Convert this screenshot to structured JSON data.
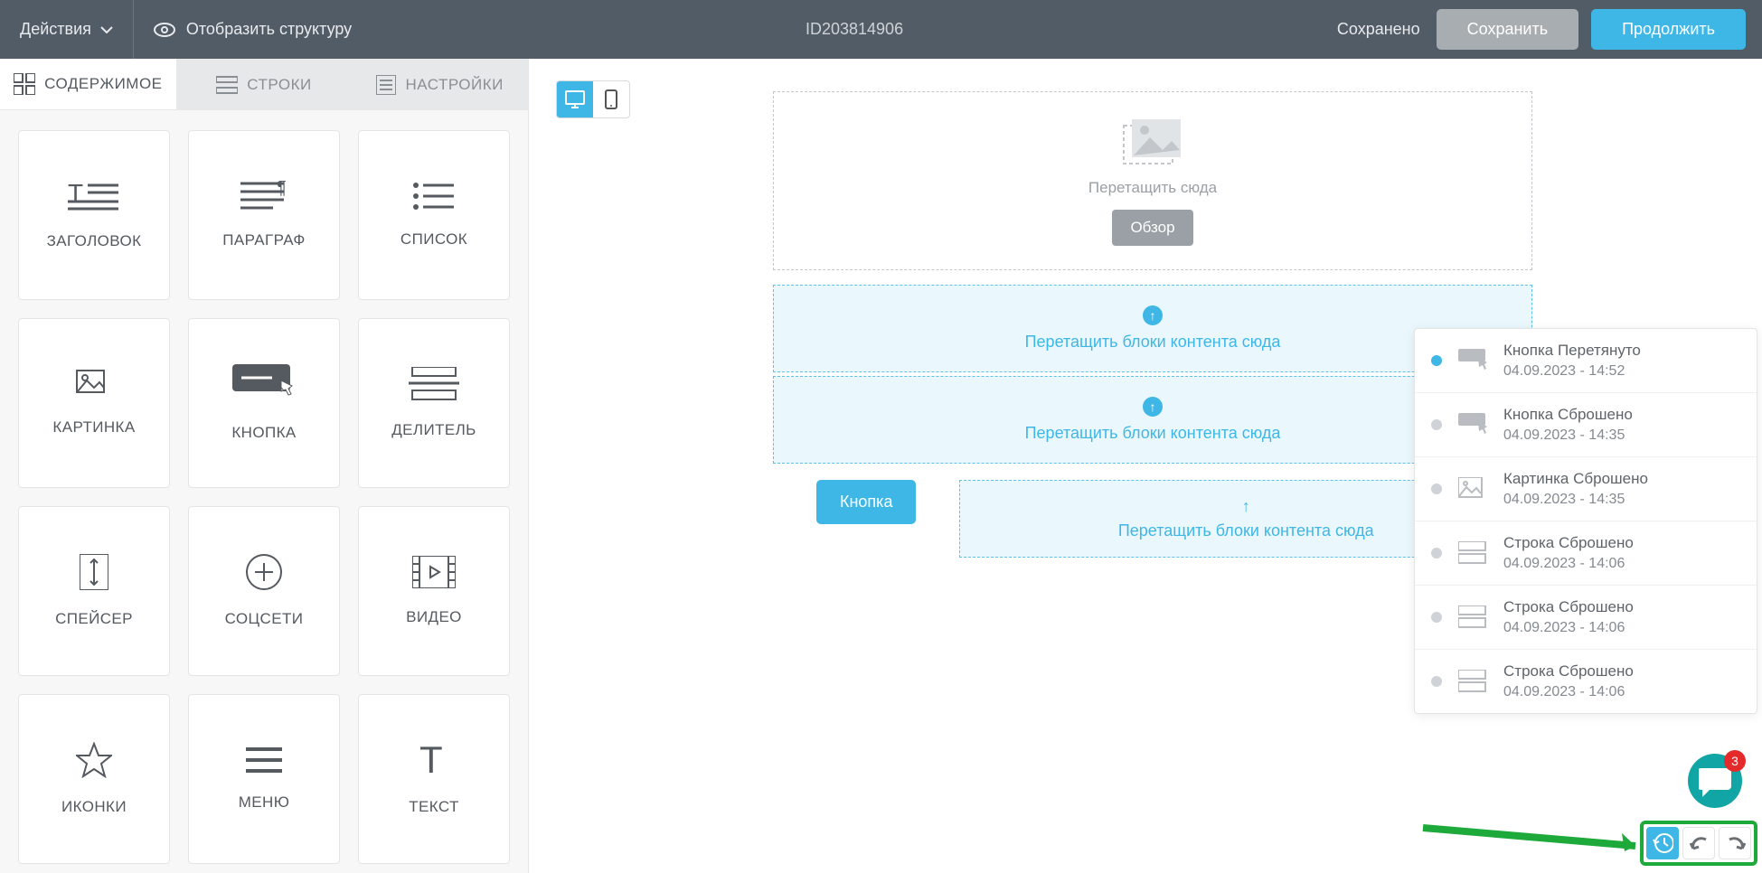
{
  "topbar": {
    "actions_label": "Действия",
    "show_structure_label": "Отобразить структуру",
    "doc_id": "ID203814906",
    "status_label": "Сохранено",
    "save_label": "Сохранить",
    "continue_label": "Продолжить"
  },
  "sidebar": {
    "tabs": {
      "content": "СОДЕРЖИМОЕ",
      "rows": "СТРОКИ",
      "settings": "НАСТРОЙКИ"
    },
    "blocks": [
      {
        "key": "heading",
        "label": "ЗАГОЛОВОК"
      },
      {
        "key": "paragraph",
        "label": "ПАРАГРАФ"
      },
      {
        "key": "list",
        "label": "СПИСОК"
      },
      {
        "key": "image",
        "label": "КАРТИНКА"
      },
      {
        "key": "button",
        "label": "КНОПКА"
      },
      {
        "key": "divider",
        "label": "ДЕЛИТЕЛЬ"
      },
      {
        "key": "spacer",
        "label": "СПЕЙСЕР"
      },
      {
        "key": "social",
        "label": "СОЦСЕТИ"
      },
      {
        "key": "video",
        "label": "ВИДЕО"
      },
      {
        "key": "icons",
        "label": "ИКОНКИ"
      },
      {
        "key": "menu",
        "label": "МЕНЮ"
      },
      {
        "key": "text",
        "label": "ТЕКСТ"
      }
    ]
  },
  "canvas": {
    "image_drop_hint": "Перетащить сюда",
    "browse_label": "Обзор",
    "content_drop_hint": "Перетащить блоки контента сюда",
    "button_element_label": "Кнопка"
  },
  "history": {
    "items": [
      {
        "icon": "button",
        "title": "Кнопка Перетянуто",
        "time": "04.09.2023 - 14:52",
        "active": true
      },
      {
        "icon": "button",
        "title": "Кнопка Сброшено",
        "time": "04.09.2023 - 14:35",
        "active": false
      },
      {
        "icon": "image",
        "title": "Картинка Сброшено",
        "time": "04.09.2023 - 14:35",
        "active": false
      },
      {
        "icon": "row",
        "title": "Строка Сброшено",
        "time": "04.09.2023 - 14:06",
        "active": false
      },
      {
        "icon": "row",
        "title": "Строка Сброшено",
        "time": "04.09.2023 - 14:06",
        "active": false
      },
      {
        "icon": "row",
        "title": "Строка Сброшено",
        "time": "04.09.2023 - 14:06",
        "active": false
      }
    ]
  },
  "chat": {
    "badge": "3"
  }
}
